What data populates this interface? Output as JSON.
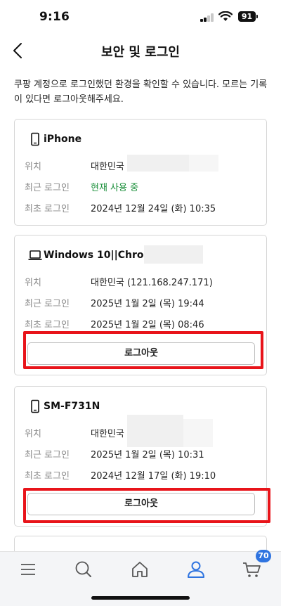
{
  "status": {
    "time": "9:16",
    "battery": "91"
  },
  "header": {
    "title": "보안 및 로그인"
  },
  "intro": "쿠팡 계정으로 로그인했던 환경을 확인할 수 있습니다. 모르는 기록이 있다면 로그아웃해주세요.",
  "labels": {
    "location": "위치",
    "recent_login": "최근 로그인",
    "first_login": "최초 로그인",
    "logout": "로그아웃"
  },
  "devices": [
    {
      "name": "iPhone",
      "icon": "phone-icon",
      "location": "대한민국",
      "recent_login": "현재 사용 중",
      "first_login": "2024년 12월 24일 (화) 10:35"
    },
    {
      "name": "Windows 10||Chrome",
      "icon": "laptop-icon",
      "location": "대한민국 (121.168.247.171)",
      "recent_login": "2025년 1월 2일 (목) 19:44",
      "first_login": "2025년 1월 2일 (목) 08:46"
    },
    {
      "name": "SM-F731N",
      "icon": "phone-icon",
      "location": "대한민국",
      "recent_login": "2025년 1월 2일 (목) 10:31",
      "first_login": "2024년 12월 17일 (화) 19:10"
    }
  ],
  "tabbar": {
    "items": [
      {
        "icon": "menu-icon"
      },
      {
        "icon": "search-icon"
      },
      {
        "icon": "home-icon"
      },
      {
        "icon": "my-account-icon"
      },
      {
        "icon": "cart-icon"
      }
    ],
    "cart_badge": "70"
  },
  "colors": {
    "accent_blue": "#2f74e0",
    "active_status_green": "#1a8f3a",
    "highlight_red": "#e8141a"
  }
}
